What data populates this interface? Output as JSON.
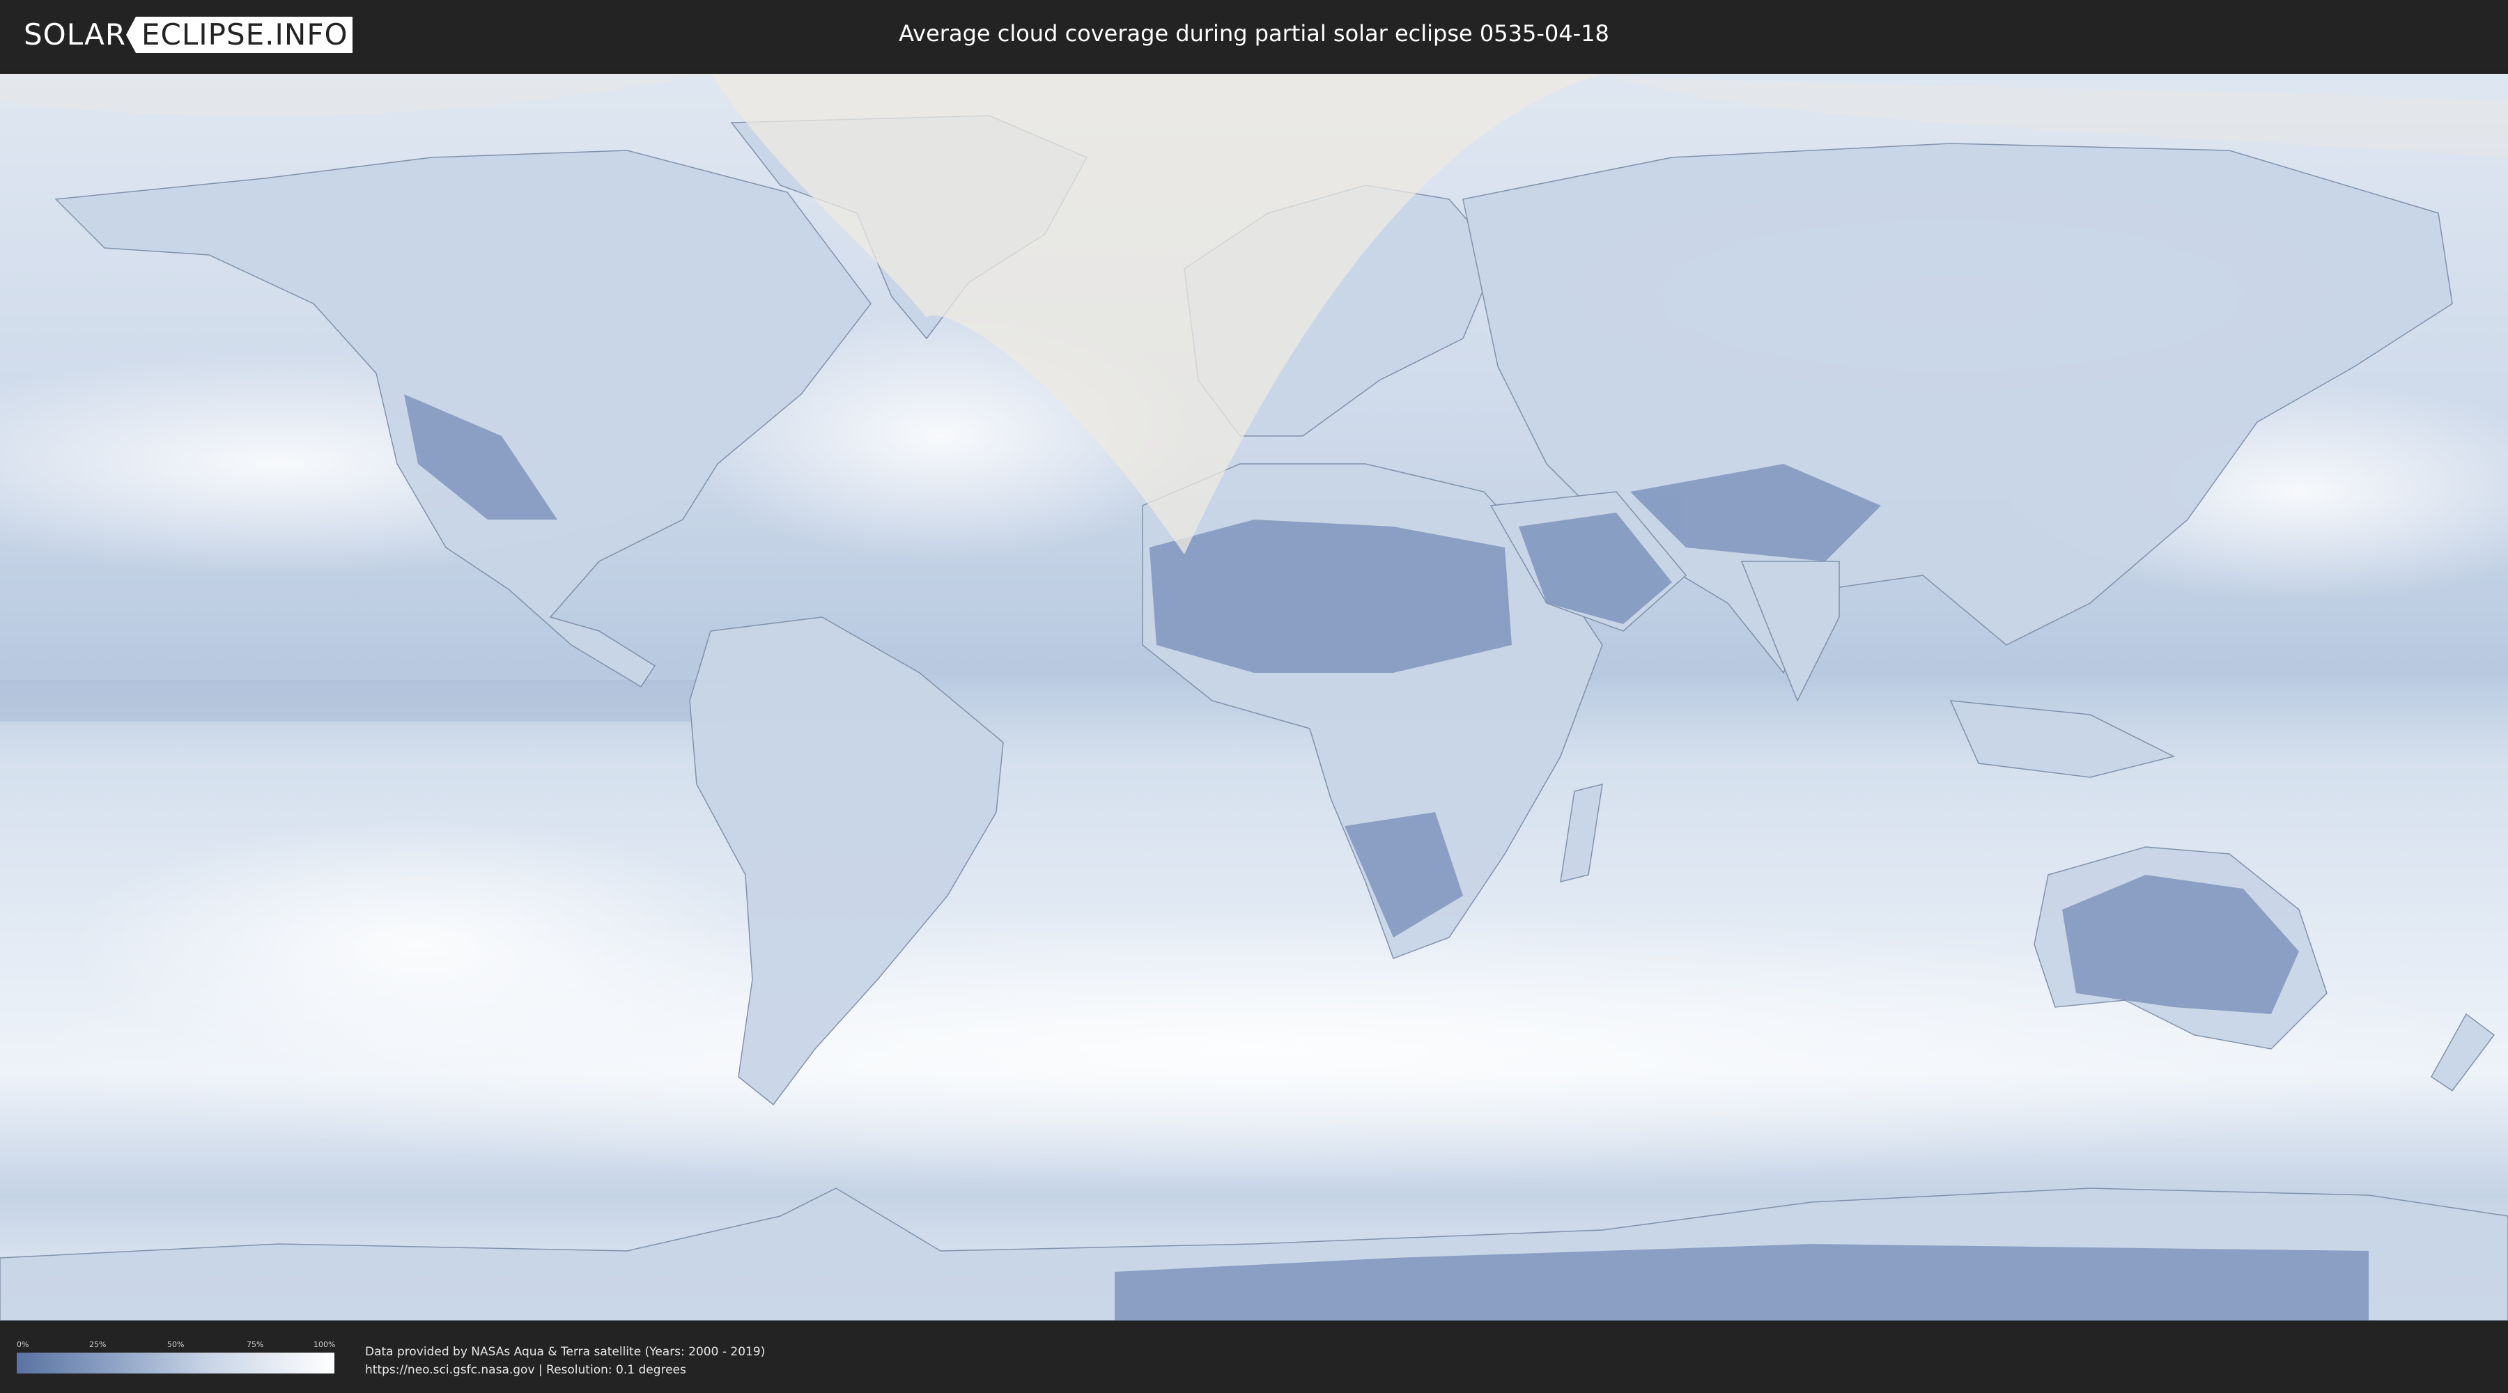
{
  "header": {
    "logo_part1": "SOLAR",
    "logo_part2": "ECLIPSE.INFO",
    "title": "Average cloud coverage during partial solar eclipse 0535-04-18"
  },
  "legend": {
    "ticks": [
      "0%",
      "25%",
      "50%",
      "75%",
      "100%"
    ],
    "gradient_colors": [
      "#5b73a2",
      "#8da2c4",
      "#c8d4e6",
      "#ffffff"
    ]
  },
  "credits": {
    "line1": "Data provided by NASAs Aqua & Terra satellite (Years: 2000 - 2019)",
    "line2": "https://neo.sci.gsfc.nasa.gov | Resolution: 0.1 degrees"
  },
  "map": {
    "ocean_color": "#e3ebf4",
    "land_cloud_color": "#6f88b4",
    "eclipse_region_color": "#ede9e2"
  }
}
